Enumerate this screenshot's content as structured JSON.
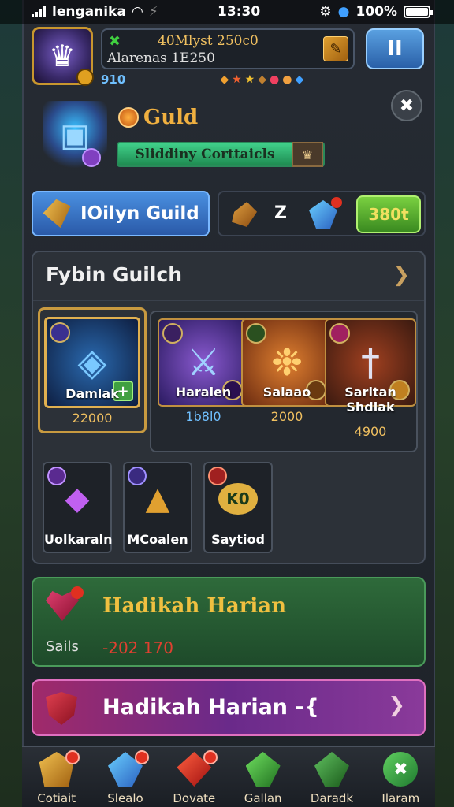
{
  "status_bar": {
    "carrier": "lenganika",
    "time": "13:30",
    "battery": "100%",
    "battery_level": 1.0
  },
  "header": {
    "info_line1": "40Mlyst 250c0",
    "info_line2": "Alarenas 1E250",
    "level": "910",
    "pause_label": "II"
  },
  "guild": {
    "title": "Guld",
    "bar_label": "Sliddiny Corttaicls"
  },
  "actions": {
    "my_guild_label": "IOilyn Guild",
    "resource_count": "Z",
    "start_label": "380t"
  },
  "panel": {
    "title": "Fybin Guilch",
    "featured": {
      "name": "Damlak",
      "cost": "22000"
    },
    "items": [
      {
        "name": "Haralen",
        "cost": "1b8l0"
      },
      {
        "name": "Salaao",
        "cost": "2000"
      },
      {
        "name": "Sarltan Shdiak",
        "cost": "4900"
      }
    ],
    "small_items": [
      {
        "name": "Uolkaraln"
      },
      {
        "name": "MCoalen"
      },
      {
        "name": "Saytiod",
        "badge": "K0"
      }
    ]
  },
  "daily_green": {
    "title": "Hadikah Harian",
    "sub": "Sails",
    "value": "-202  170"
  },
  "daily_pink": {
    "title": "Hadikah Harian -{"
  },
  "bottom_nav": [
    {
      "label": "Cotiait"
    },
    {
      "label": "Slealo"
    },
    {
      "label": "Dovate"
    },
    {
      "label": "Gallan"
    },
    {
      "label": "Daradk"
    },
    {
      "label": "Ilaram"
    }
  ]
}
